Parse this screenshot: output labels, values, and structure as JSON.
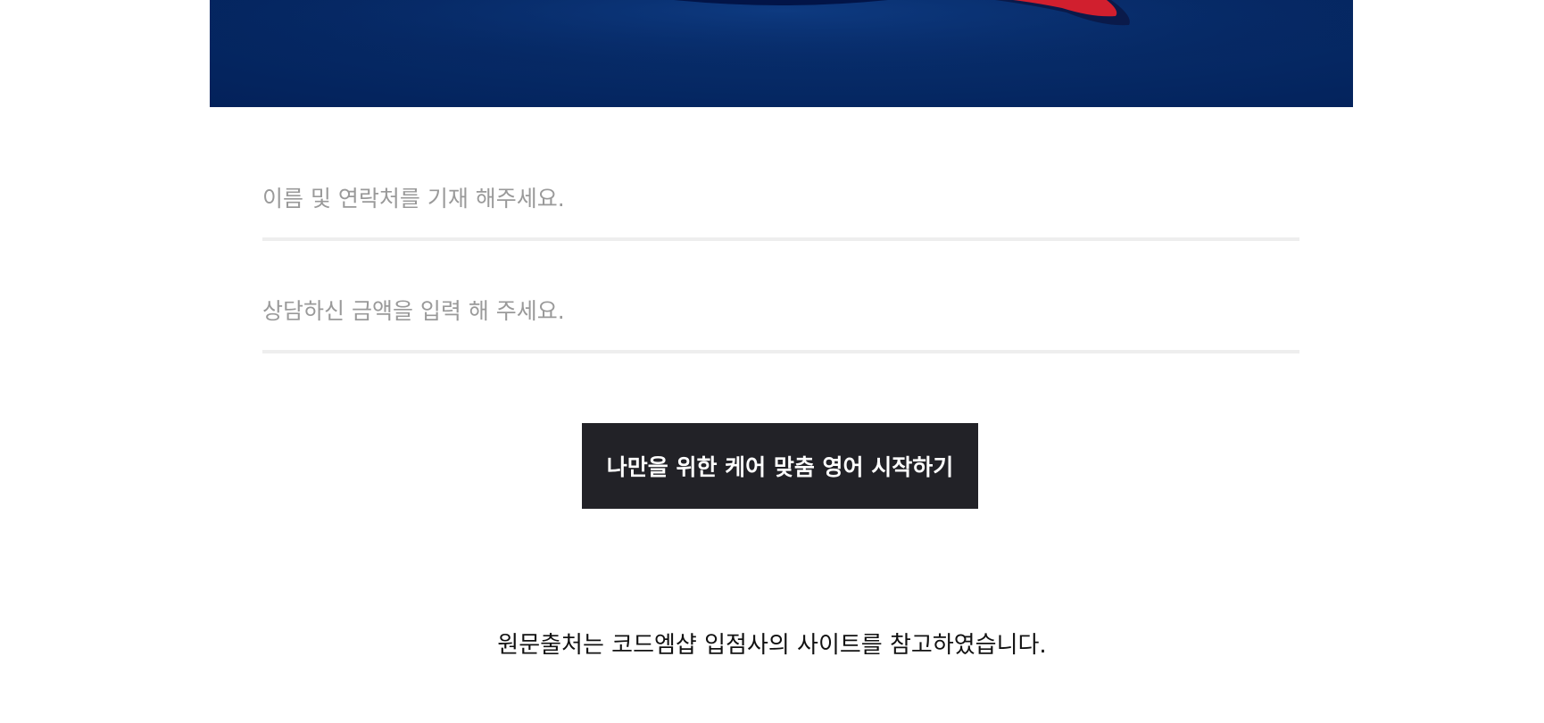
{
  "hero": {
    "image_name": "blue-banner-illustration"
  },
  "form": {
    "name_contact_placeholder": "이름 및 연락처를 기재 해주세요.",
    "amount_placeholder": "상담하신 금액을 입력 해 주세요.",
    "submit_label": "나만을 위한 케어 맞춤 영어 시작하기"
  },
  "footer": {
    "credit_text": "원문출처는 코드엠샵 입점사의 사이트를 참고하였습니다."
  },
  "colors": {
    "hero_background": "#062a66",
    "accent_red": "#d11f2e",
    "button_background": "#222227",
    "underline": "#eeeeee",
    "placeholder": "#9a9a9a"
  }
}
